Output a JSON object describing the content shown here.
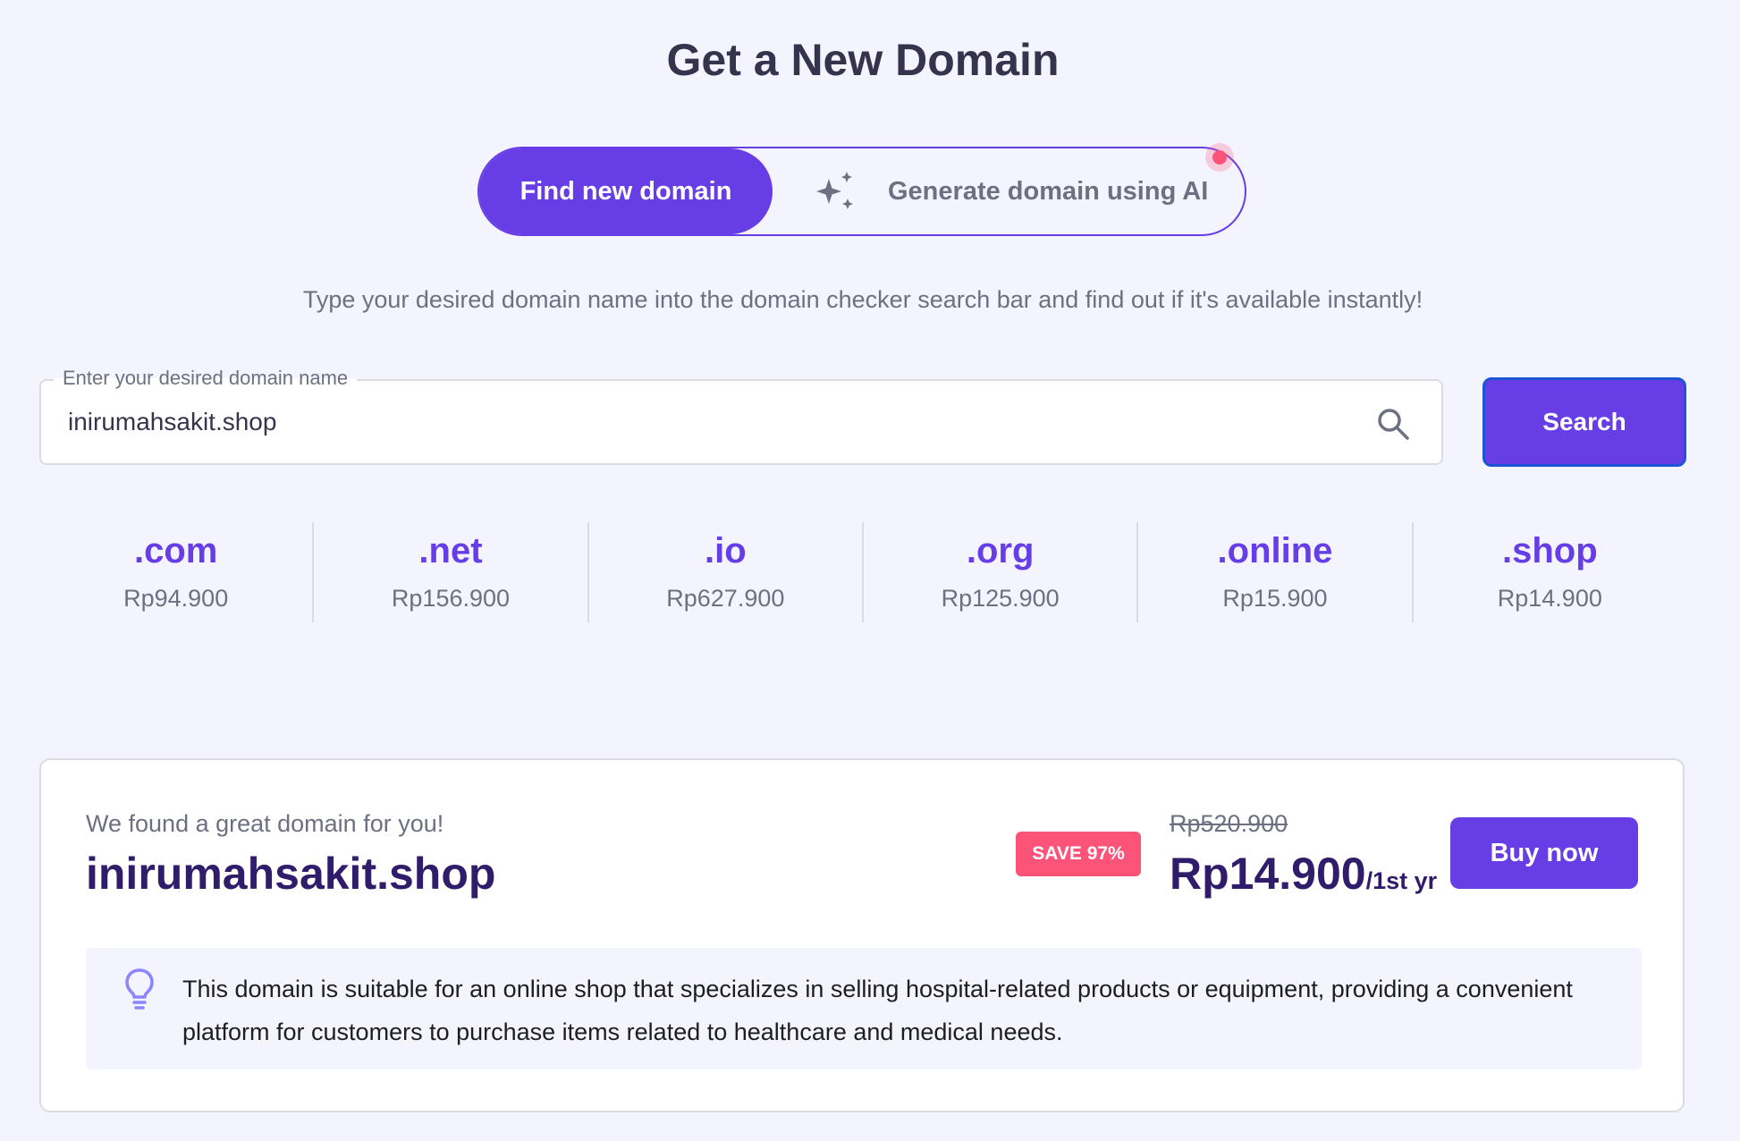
{
  "header": {
    "title": "Get a New Domain"
  },
  "mode_toggle": {
    "active_label": "Find new domain",
    "ai_label": "Generate domain using AI"
  },
  "intro": "Type your desired domain name into the domain checker search bar and find out if it's available instantly!",
  "search": {
    "legend": "Enter your desired domain name",
    "value": "inirumahsakit.shop",
    "button_label": "Search"
  },
  "tlds": [
    {
      "name": ".com",
      "price": "Rp94.900"
    },
    {
      "name": ".net",
      "price": "Rp156.900"
    },
    {
      "name": ".io",
      "price": "Rp627.900"
    },
    {
      "name": ".org",
      "price": "Rp125.900"
    },
    {
      "name": ".online",
      "price": "Rp15.900"
    },
    {
      "name": ".shop",
      "price": "Rp14.900"
    }
  ],
  "result": {
    "label": "We found a great domain for you!",
    "domain": "inirumahsakit.shop",
    "badge": "SAVE 97%",
    "old_price": "Rp520.900",
    "price": "Rp14.900",
    "period": "/1st yr",
    "buy_label": "Buy now",
    "tip": "This domain is suitable for an online shop that specializes in selling hospital-related products or equipment, providing a convenient platform for customers to purchase items related to healthcare and medical needs."
  },
  "icons": {
    "ai": "sparkles-icon",
    "search": "search-icon",
    "tip": "lightbulb-icon",
    "notification": "notification-dot"
  },
  "colors": {
    "primary": "#673DE6",
    "accent_pink": "#FC5379",
    "background": "#F4F4FF",
    "heading": "#36344D",
    "dark_text": "#2F1C6A",
    "muted_text": "#6D7081"
  }
}
